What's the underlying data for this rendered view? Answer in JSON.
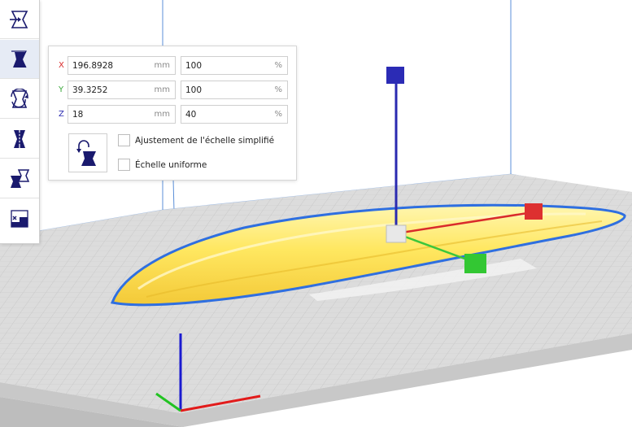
{
  "toolbar": {
    "tools": [
      {
        "name": "move-tool",
        "icon": "move-icon"
      },
      {
        "name": "scale-tool",
        "icon": "scale-icon",
        "active": true
      },
      {
        "name": "rotate-tool",
        "icon": "rotate-icon"
      },
      {
        "name": "mirror-tool",
        "icon": "mirror-icon"
      },
      {
        "name": "per-model-settings-tool",
        "icon": "per-model-settings-icon"
      },
      {
        "name": "support-blocker-tool",
        "icon": "support-blocker-icon"
      }
    ]
  },
  "scale_panel": {
    "x": {
      "axis": "X",
      "size": "196.8928",
      "size_unit": "mm",
      "percent": "100",
      "percent_unit": "%",
      "color": "#d92b2b"
    },
    "y": {
      "axis": "Y",
      "size": "39.3252",
      "size_unit": "mm",
      "percent": "100",
      "percent_unit": "%",
      "color": "#3aa83a"
    },
    "z": {
      "axis": "Z",
      "size": "18",
      "size_unit": "mm",
      "percent": "40",
      "percent_unit": "%",
      "color": "#2a2ab0"
    },
    "lock_button_icon": "lock-model-icon",
    "snap_scaling_label": "Ajustement de l'échelle simplifié",
    "snap_scaling_checked": false,
    "uniform_scaling_label": "Échelle uniforme",
    "uniform_scaling_checked": false
  },
  "colors": {
    "accent": "#1a1a6e",
    "selection_outline": "#2f6fe0",
    "model_fill": "#ffe25a",
    "build_plate": "#d9d9d9",
    "gizmo_x": "#d92b2b",
    "gizmo_y": "#3cc63c",
    "gizmo_z": "#2a2ab0"
  }
}
